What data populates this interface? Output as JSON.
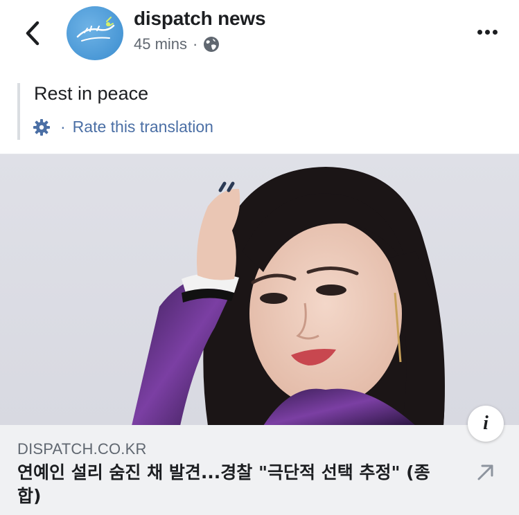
{
  "header": {
    "page_name": "dispatch news",
    "time": "45 mins",
    "separator": "·",
    "avatar_logo_text": "디스패치"
  },
  "post": {
    "text": "Rest in peace",
    "translation_separator": "·",
    "rate_translation_label": "Rate this translation"
  },
  "link_preview": {
    "domain": "DISPATCH.CO.KR",
    "headline": "연예인 설리 숨진 채 발견...경찰 \"극단적 선택 추정\" (종합)",
    "info_label": "i"
  },
  "icons": {
    "back": "chevron-left-icon",
    "more": "more-dots-icon",
    "globe": "globe-icon",
    "gear": "gear-icon",
    "external": "arrow-up-right-icon",
    "info": "info-icon"
  },
  "colors": {
    "link_blue": "#4b6fa5",
    "text_dark": "#1c1e21",
    "text_gray": "#606770",
    "avatar_blue": "#4a98d6",
    "preview_bg": "#f0f1f3"
  }
}
